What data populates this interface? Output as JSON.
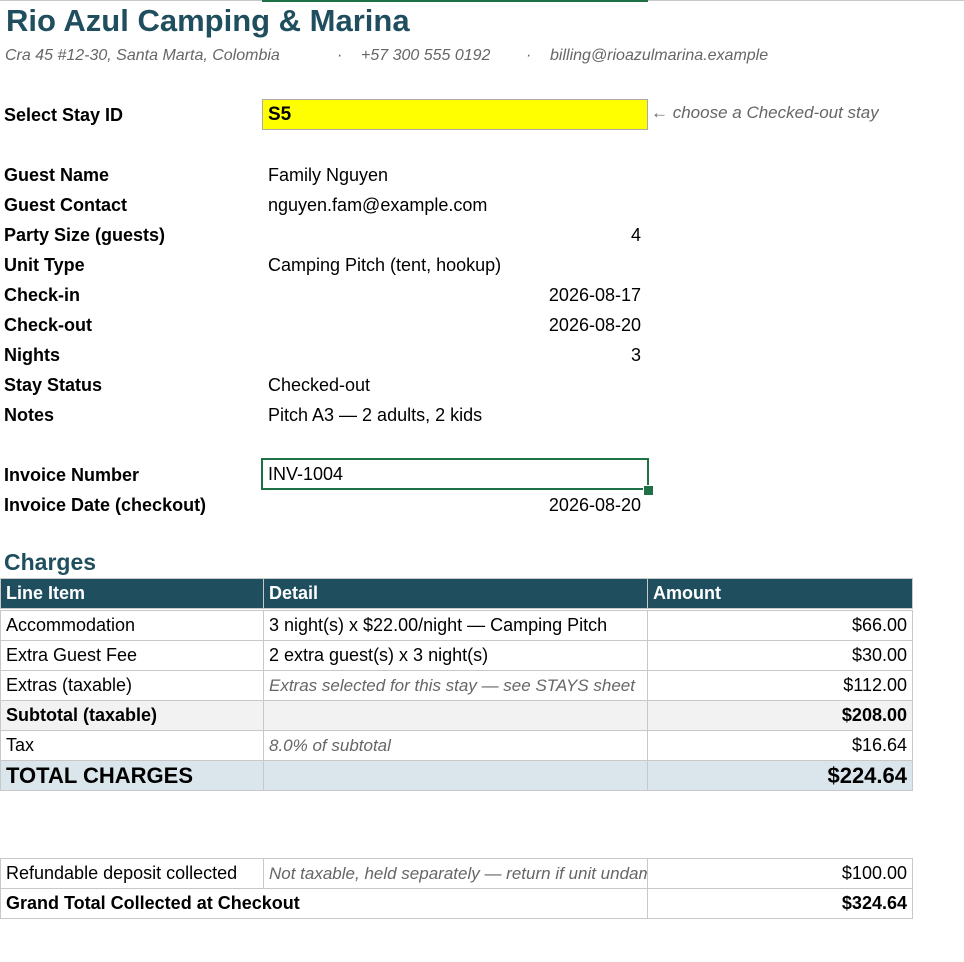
{
  "company": {
    "name": "Rio Azul Camping & Marina",
    "address": "Cra 45 #12-30, Santa Marta, Colombia",
    "phone": "+57 300 555 0192",
    "email": "billing@rioazulmarina.example",
    "separator": "·"
  },
  "selector": {
    "label": "Select Stay ID",
    "value": "S5",
    "hint": "← choose a Checked-out stay"
  },
  "guest": {
    "name_label": "Guest Name",
    "name": "Family Nguyen",
    "contact_label": "Guest Contact",
    "contact": "nguyen.fam@example.com",
    "party_label": "Party Size (guests)",
    "party": "4",
    "unit_label": "Unit Type",
    "unit": "Camping Pitch (tent, hookup)",
    "checkin_label": "Check-in",
    "checkin": "2026-08-17",
    "checkout_label": "Check-out",
    "checkout": "2026-08-20",
    "nights_label": "Nights",
    "nights": "3",
    "status_label": "Stay Status",
    "status": "Checked-out",
    "notes_label": "Notes",
    "notes": "Pitch A3 — 2 adults, 2 kids"
  },
  "invoice": {
    "number_label": "Invoice Number",
    "number": "INV-1004",
    "date_label": "Invoice Date (checkout)",
    "date": "2026-08-20"
  },
  "charges": {
    "heading": "Charges",
    "headers": {
      "item": "Line Item",
      "detail": "Detail",
      "amount": "Amount"
    },
    "rows": [
      {
        "item": "Accommodation",
        "detail": "3 night(s) x $22.00/night — Camping Pitch",
        "amount": "$66.00"
      },
      {
        "item": "Extra Guest Fee",
        "detail": "2 extra guest(s) x 3 night(s)",
        "amount": "$30.00"
      },
      {
        "item": "Extras (taxable)",
        "detail": "Extras selected for this stay — see STAYS sheet",
        "amount": "$112.00"
      }
    ],
    "subtotal": {
      "label": "Subtotal (taxable)",
      "amount": "$208.00"
    },
    "tax": {
      "label": "Tax",
      "detail": "8.0% of subtotal",
      "amount": "$16.64"
    },
    "total": {
      "label": "TOTAL CHARGES",
      "amount": "$224.64"
    }
  },
  "deposit": {
    "label": "Refundable deposit collected",
    "detail": "Not taxable, held separately — return if unit undamaged",
    "amount": "$100.00"
  },
  "grand": {
    "label": "Grand Total Collected at Checkout",
    "amount": "$324.64"
  }
}
